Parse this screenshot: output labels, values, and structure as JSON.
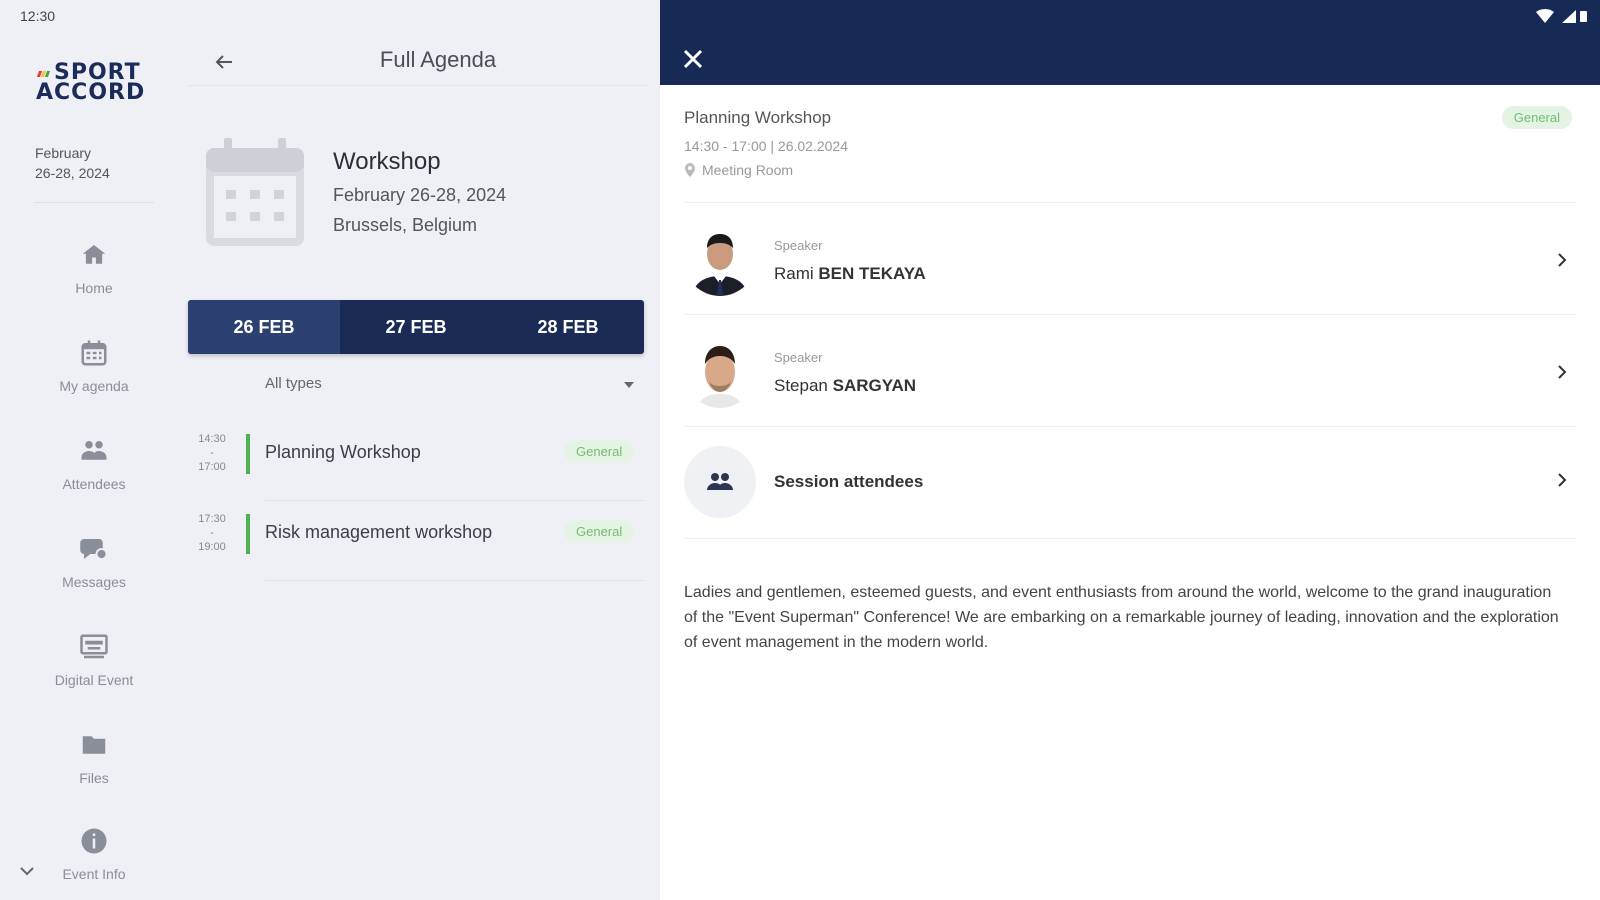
{
  "status": {
    "time": "12:30"
  },
  "brand": {
    "line1": "SPORT",
    "line2": "ACCORD",
    "tick_colors": [
      "#e53935",
      "#fbc02d",
      "#43a047"
    ]
  },
  "rail": {
    "date_line1": "February",
    "date_line2": "26-28, 2024",
    "items": [
      {
        "label": "Home",
        "icon": "home-icon"
      },
      {
        "label": "My agenda",
        "icon": "calendar-icon"
      },
      {
        "label": "Attendees",
        "icon": "attendees-icon"
      },
      {
        "label": "Messages",
        "icon": "messages-icon"
      },
      {
        "label": "Digital Event",
        "icon": "digital-event-icon"
      },
      {
        "label": "Files",
        "icon": "folder-icon"
      },
      {
        "label": "Event Info",
        "icon": "info-icon"
      }
    ]
  },
  "agenda": {
    "title": "Full Agenda",
    "event": {
      "name": "Workshop",
      "date": "February 26-28, 2024",
      "place": "Brussels, Belgium"
    },
    "tabs": [
      "26 FEB",
      "27 FEB",
      "28 FEB"
    ],
    "filter": "All types",
    "sessions": [
      {
        "start": "14:30",
        "end": "17:00",
        "title": "Planning Workshop",
        "badge": "General"
      },
      {
        "start": "17:30",
        "end": "19:00",
        "title": "Risk management workshop",
        "badge": "General"
      }
    ]
  },
  "detail": {
    "title": "Planning Workshop",
    "badge": "General",
    "time": "14:30 - 17:00 | 26.02.2024",
    "location": "Meeting Room",
    "speakers": [
      {
        "kicker": "Speaker",
        "first": "Rami",
        "last": "BEN TEKAYA"
      },
      {
        "kicker": "Speaker",
        "first": "Stepan",
        "last": "SARGYAN"
      }
    ],
    "attendees_label": "Session attendees",
    "description": "Ladies and gentlemen, esteemed guests, and event enthusiasts from around the world, welcome to the grand inauguration of the \"Event Superman\" Conference! We are embarking on a remarkable journey of leading, innovation and the exploration of event management in the modern world."
  },
  "colors": {
    "navy": "#162a55",
    "tab_active": "#2c4170",
    "accent_green": "#4caf50",
    "badge_bg": "#e5f3e5"
  }
}
